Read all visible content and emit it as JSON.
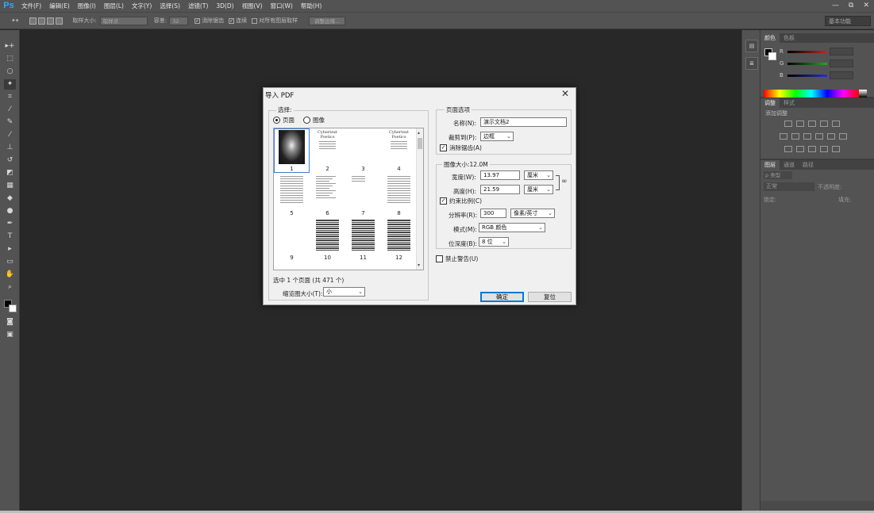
{
  "app": {
    "logo": "Ps"
  },
  "menu": [
    "文件(F)",
    "编辑(E)",
    "图像(I)",
    "图层(L)",
    "文字(Y)",
    "选择(S)",
    "滤镜(T)",
    "3D(D)",
    "视图(V)",
    "窗口(W)",
    "帮助(H)"
  ],
  "window_controls": [
    "—",
    "⧉",
    "✕"
  ],
  "options_bar": {
    "sample_size_label": "取样大小:",
    "sample_size_value": "取样点",
    "tolerance_label": "容差:",
    "tolerance_value": "32",
    "antialias_label": "消除锯齿",
    "contiguous_label": "连续",
    "all_layers_label": "对所有图层取样",
    "refine_edge_label": "调整边缘...",
    "workspace": "基本功能"
  },
  "color_panel": {
    "tabs": [
      "颜色",
      "色板"
    ],
    "channels": [
      "R",
      "G",
      "B"
    ],
    "colors": {
      "r": "#cc2222",
      "g": "#22aa22",
      "b": "#2233cc"
    }
  },
  "adjust_panel": {
    "tabs": [
      "调整",
      "样式"
    ],
    "title": "添加调整"
  },
  "layers_panel": {
    "tabs": [
      "图层",
      "通道",
      "路径"
    ],
    "kind_label": "ρ 类型",
    "blend_mode": "正常",
    "opacity_label": "不透明度:",
    "lock_label": "锁定:",
    "fill_label": "填充:"
  },
  "dialog": {
    "title": "导入 PDF",
    "close": "✕",
    "select_group": {
      "legend": "选择:",
      "option_pages": "页面",
      "option_images": "图像",
      "thumbnails": [
        {
          "num": "1",
          "kind": "image"
        },
        {
          "num": "2",
          "kind": "title",
          "title": "Cybertext Poetics"
        },
        {
          "num": "3",
          "kind": "blank"
        },
        {
          "num": "4",
          "kind": "title",
          "title": "Cybertext Poetics"
        },
        {
          "num": "5",
          "kind": "text"
        },
        {
          "num": "6",
          "kind": "toc"
        },
        {
          "num": "7",
          "kind": "sparse"
        },
        {
          "num": "8",
          "kind": "text"
        },
        {
          "num": "9",
          "kind": "blank"
        },
        {
          "num": "10",
          "kind": "dense"
        },
        {
          "num": "11",
          "kind": "dense"
        },
        {
          "num": "12",
          "kind": "dense"
        }
      ],
      "selection_status": "选中 1 个页面 (共 471 个)",
      "thumb_size_label": "缩览图大小(T):",
      "thumb_size_value": "小"
    },
    "page_options": {
      "legend": "页面选项",
      "name_label": "名称(N):",
      "name_value": "演示文档2",
      "crop_label": "裁剪到(P):",
      "crop_value": "边框",
      "antialias_label": "消除锯齿(A)"
    },
    "image_size": {
      "legend": "图像大小:12.0M",
      "width_label": "宽度(W):",
      "width_value": "13.97",
      "width_unit": "厘米",
      "height_label": "高度(H):",
      "height_value": "21.59",
      "height_unit": "厘米",
      "constrain_label": "约束比例(C)",
      "resolution_label": "分辨率(R):",
      "resolution_value": "300",
      "resolution_unit": "像素/英寸",
      "mode_label": "模式(M):",
      "mode_value": "RGB 颜色",
      "depth_label": "位深度(B):",
      "depth_value": "8 位"
    },
    "suppress_label": "禁止警告(U)",
    "ok_label": "确定",
    "reset_label": "复位"
  }
}
